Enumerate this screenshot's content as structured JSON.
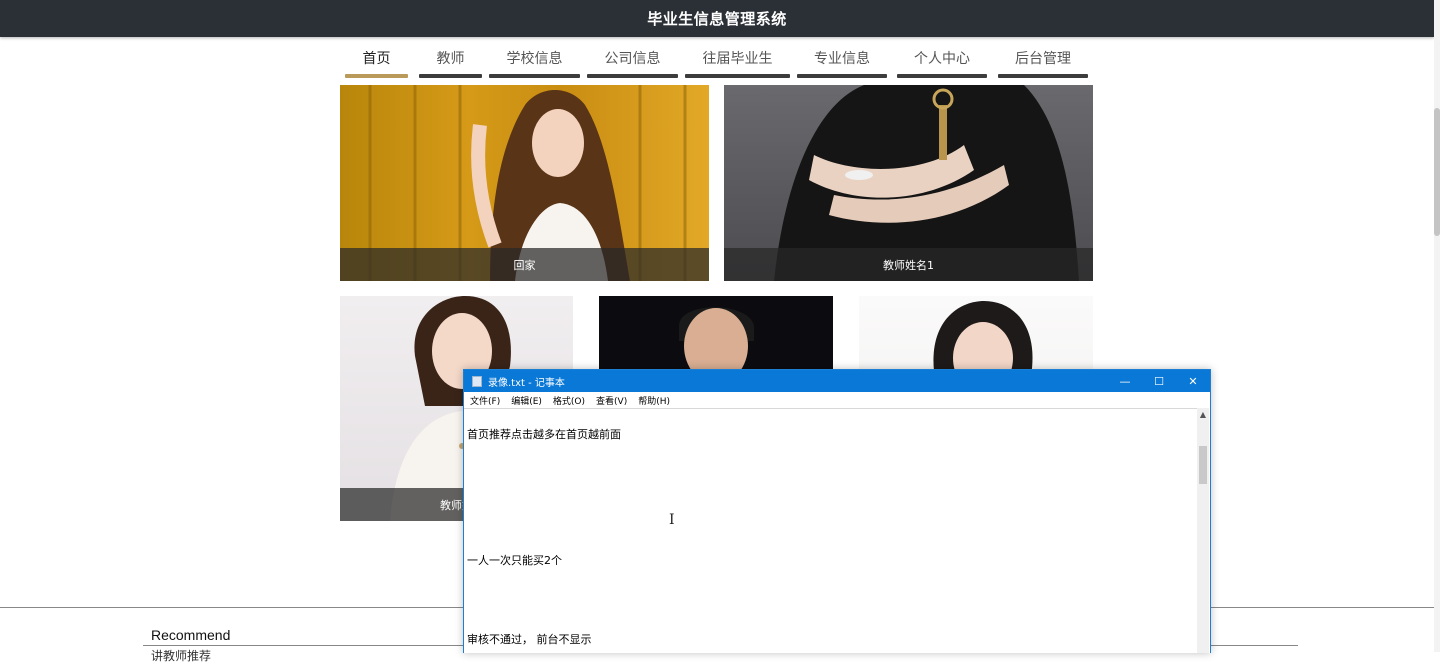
{
  "header": {
    "title": "毕业生信息管理系统"
  },
  "nav": {
    "items": [
      {
        "label": "首页",
        "active": true
      },
      {
        "label": "教师"
      },
      {
        "label": "学校信息"
      },
      {
        "label": "公司信息"
      },
      {
        "label": "往届毕业生"
      },
      {
        "label": "专业信息"
      },
      {
        "label": "个人中心"
      },
      {
        "label": "后台管理"
      }
    ],
    "accent_color": "#b99a5a"
  },
  "cards": [
    {
      "caption": "回家"
    },
    {
      "caption": "教师姓名1"
    },
    {
      "caption": "教师姓"
    },
    {
      "caption": ""
    },
    {
      "caption": ""
    }
  ],
  "footer": {
    "recommend": "Recommend",
    "recommend_sub": "讲教师推荐"
  },
  "notepad": {
    "title": "录像.txt - 记事本",
    "menu": [
      "文件(F)",
      "编辑(E)",
      "格式(O)",
      "查看(V)",
      "帮助(H)"
    ],
    "lines": [
      "首页推荐点击越多在首页越前面",
      "一人一次只能买2个",
      "审核不通过， 前台不显示"
    ],
    "controls": {
      "minimize": "—",
      "maximize": "☐",
      "close": "✕"
    }
  }
}
